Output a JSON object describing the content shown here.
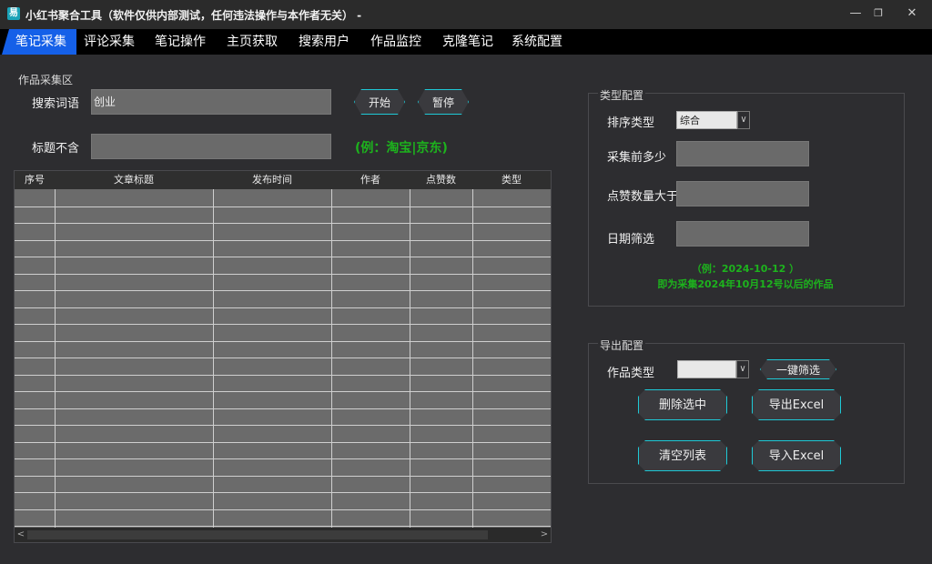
{
  "window": {
    "title": "小红书聚合工具（软件仅供内部测试，任何违法操作与本作者无关） -",
    "icon": "app-logo-icon",
    "controls": {
      "minimize": "—",
      "restore": "❐",
      "close": "✕"
    }
  },
  "tabs": [
    {
      "label": "笔记采集",
      "active": true
    },
    {
      "label": "评论采集"
    },
    {
      "label": "笔记操作"
    },
    {
      "label": "主页获取"
    },
    {
      "label": "搜索用户"
    },
    {
      "label": "作品监控"
    },
    {
      "label": "克隆笔记"
    },
    {
      "label": "系统配置"
    }
  ],
  "collect": {
    "section_label": "作品采集区",
    "search_label": "搜索词语",
    "search_value": "创业",
    "exclude_label": "标题不含",
    "exclude_value": "",
    "exclude_hint": "(例：淘宝|京东)",
    "start_button": "开始",
    "pause_button": "暂停"
  },
  "table": {
    "columns": [
      "序号",
      "文章标题",
      "发布时间",
      "作者",
      "点赞数",
      "类型"
    ],
    "rows": 20,
    "scroll_left": "<",
    "scroll_right": ">"
  },
  "type_config": {
    "section_label": "类型配置",
    "sort_label": "排序类型",
    "sort_value": "综合",
    "count_label": "采集前多少",
    "count_value": "",
    "likes_label": "点赞数量大于",
    "likes_value": "",
    "date_label": "日期筛选",
    "date_value": "",
    "date_hint_1": "（例：2024-10-12 ）",
    "date_hint_2": "即为采集2024年10月12号以后的作品"
  },
  "export_config": {
    "section_label": "导出配置",
    "type_label": "作品类型",
    "type_value": "",
    "filter_button": "一键筛选",
    "delete_button": "删除选中",
    "export_button": "导出Excel",
    "clear_button": "清空列表",
    "import_button": "导入Excel"
  },
  "colors": {
    "accent": "#1560e8",
    "button_border": "#1ec9d6",
    "hint_green": "#1db31d",
    "background": "#2d2d30"
  }
}
